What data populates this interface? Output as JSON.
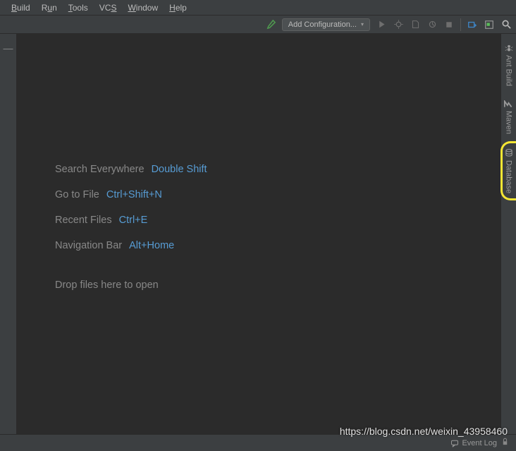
{
  "menu": {
    "build": "Build",
    "run": "Run",
    "tools": "Tools",
    "vcs": "VCS",
    "window": "Window",
    "help": "Help"
  },
  "toolbar": {
    "add_configuration": "Add Configuration..."
  },
  "welcome": {
    "items": [
      {
        "label": "Search Everywhere",
        "key": "Double Shift"
      },
      {
        "label": "Go to File",
        "key": "Ctrl+Shift+N"
      },
      {
        "label": "Recent Files",
        "key": "Ctrl+E"
      },
      {
        "label": "Navigation Bar",
        "key": "Alt+Home"
      }
    ],
    "drop": "Drop files here to open"
  },
  "side_tabs": {
    "ant": "Ant Build",
    "maven": "Maven",
    "database": "Database"
  },
  "status": {
    "event_log": "Event Log"
  },
  "watermark": "https://blog.csdn.net/weixin_43958460"
}
